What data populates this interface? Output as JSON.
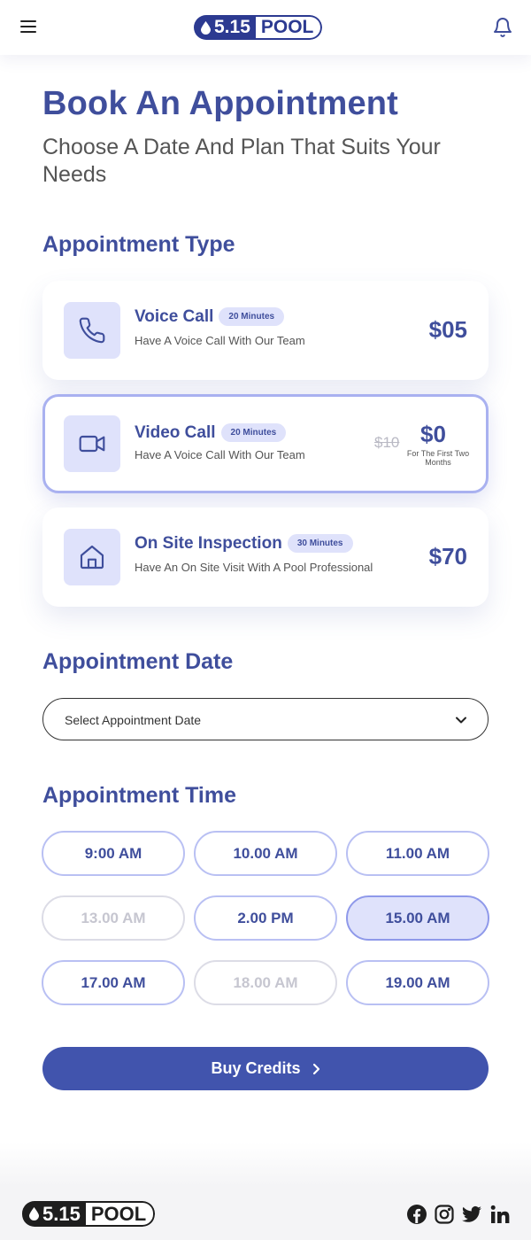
{
  "brand": {
    "number": "5.15",
    "word": "POOL"
  },
  "colors": {
    "primary": "#3f4e9c",
    "accent_button": "#4154ad",
    "tint": "#dfe2fb"
  },
  "header": {
    "menu_icon": "hamburger-menu-icon",
    "notification_icon": "bell-icon"
  },
  "hero": {
    "title": "Book An Appointment",
    "subtitle": "Choose A Date And Plan That Suits Your Needs"
  },
  "appointment_type": {
    "title": "Appointment Type",
    "options": [
      {
        "icon": "phone-icon",
        "name": "Voice Call",
        "duration": "20 Minutes",
        "description": "Have A Voice Call With Our Team",
        "price": "$05",
        "selected": false
      },
      {
        "icon": "video-camera-icon",
        "name": "Video Call",
        "duration": "20 Minutes",
        "description": "Have A Voice Call With Our Team",
        "old_price": "$10",
        "price": "$0",
        "price_note": "For The First Two Months",
        "selected": true
      },
      {
        "icon": "home-icon",
        "name": "On Site Inspection",
        "duration": "30 Minutes",
        "description": "Have An On Site Visit With A Pool Professional",
        "price": "$70",
        "selected": false
      }
    ]
  },
  "appointment_date": {
    "title": "Appointment Date",
    "placeholder": "Select Appointment Date"
  },
  "appointment_time": {
    "title": "Appointment Time",
    "slots": [
      {
        "label": "9:00 AM",
        "state": "available"
      },
      {
        "label": "10.00 AM",
        "state": "available"
      },
      {
        "label": "11.00 AM",
        "state": "available"
      },
      {
        "label": "13.00 AM",
        "state": "disabled"
      },
      {
        "label": "2.00 PM",
        "state": "available"
      },
      {
        "label": "15.00 AM",
        "state": "selected"
      },
      {
        "label": "17.00 AM",
        "state": "available"
      },
      {
        "label": "18.00 AM",
        "state": "disabled"
      },
      {
        "label": "19.00 AM",
        "state": "available"
      }
    ]
  },
  "cta": {
    "label": "Buy Credits"
  },
  "footer": {
    "social": [
      "facebook-icon",
      "instagram-icon",
      "twitter-icon",
      "linkedin-icon"
    ]
  }
}
